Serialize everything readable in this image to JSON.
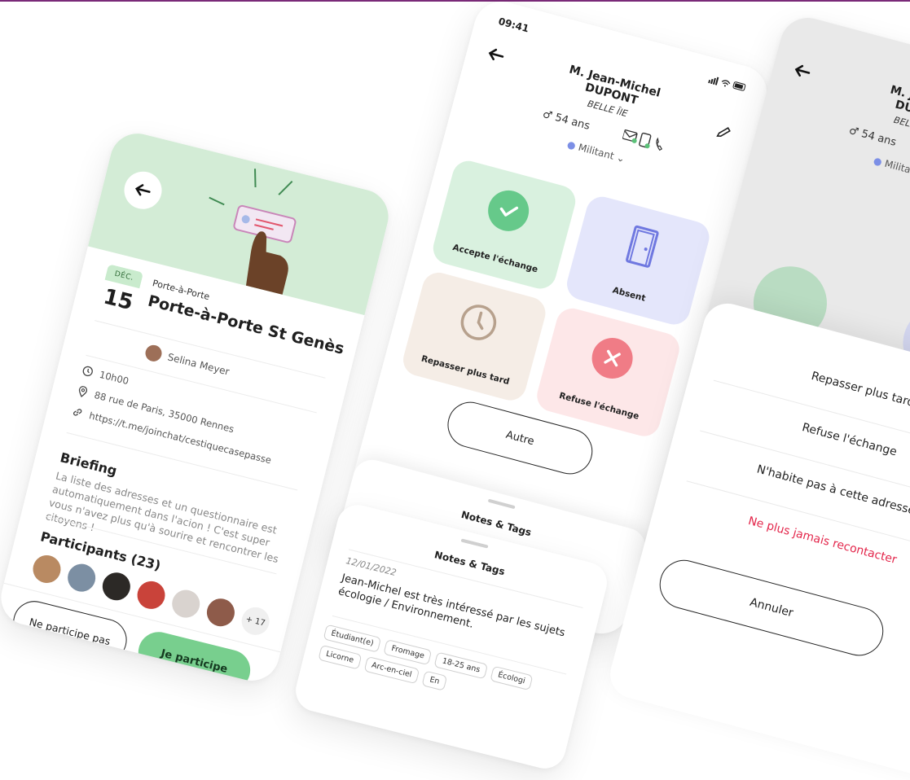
{
  "event_card": {
    "month": "DÉC.",
    "day": "15",
    "type": "Porte-à-Porte",
    "title": "Porte-à-Porte St Genès",
    "organizer": "Selina Meyer",
    "time": "10h00",
    "address": "88 rue de Paris, 35000 Rennes",
    "link": "https://t.me/joinchat/cestiquecasepasse",
    "briefing_title": "Briefing",
    "briefing_text": "La liste des adresses et un questionnaire est automatiquement dans l'acion ! C'est super vous n'avez plus qu'à sourire et rencontrer les citoyens !",
    "participants_title": "Participants (23)",
    "more_count": "+ 17",
    "decline_label": "Ne participe pas",
    "join_label": "Je participe",
    "colors": {
      "hero": "#d3ecd6",
      "join": "#78cf8e"
    }
  },
  "contact_card": {
    "status_time": "09:41",
    "name_line1": "M. Jean-Michel",
    "name_line2": "DUPONT",
    "city": "BELLE ÎlE",
    "age": "54 ans",
    "role": "Militant",
    "tiles": [
      {
        "label": "Accepte l'échange",
        "icon": "check-icon",
        "bg": "#d9f1df",
        "circle": "#66c98a"
      },
      {
        "label": "Absent",
        "icon": "door-icon",
        "bg": "#e4e6fb",
        "circle": "transparent"
      },
      {
        "label": "Repasser plus tard",
        "icon": "clock-icon",
        "bg": "#f5ede6",
        "circle": "transparent"
      },
      {
        "label": "Refuse l'échange",
        "icon": "cross-icon",
        "bg": "#fde7e8",
        "circle": "#f07c86"
      }
    ],
    "other_label": "Autre",
    "sheet_title": "Notes & Tags"
  },
  "notes_sheet": {
    "title": "Notes & Tags",
    "date": "12/01/2022",
    "note": "Jean-Michel est très intéressé par les sujets écologie / Environnement.",
    "tags": [
      "Étudiant(e)",
      "Fromage",
      "18-25 ans",
      "Écologi",
      "Licorne",
      "Arc-en-ciel",
      "En"
    ]
  },
  "action_card": {
    "name_line1": "M. Jean-M",
    "name_line2": "DUPON",
    "city": "BELLE ÎlE",
    "age": "54 ans",
    "role": "Militant",
    "options": [
      "Repasser plus tard",
      "Refuse l'échange",
      "N'habite pas à cette adresse"
    ],
    "danger_option": "Ne plus jamais recontacter",
    "cancel_label": "Annuler"
  }
}
